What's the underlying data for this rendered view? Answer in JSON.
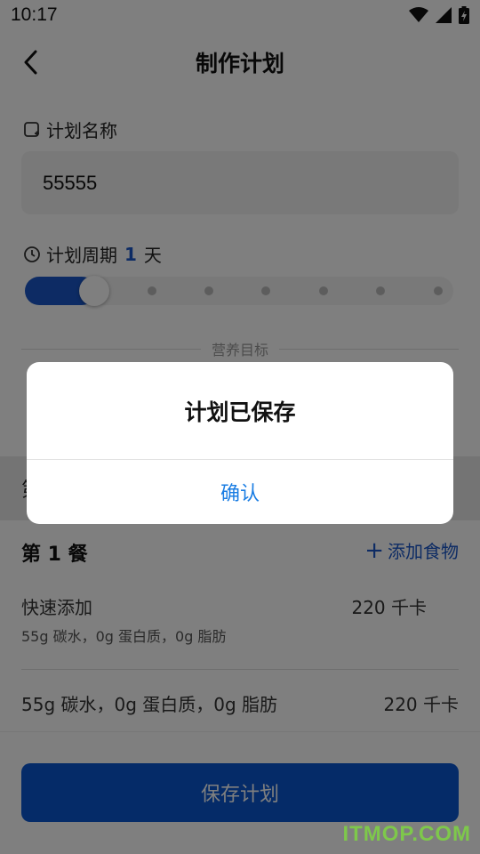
{
  "status_bar": {
    "time": "10:17",
    "icons": [
      "wifi-icon",
      "signal-icon",
      "battery-charging-icon"
    ]
  },
  "header": {
    "title": "制作计划",
    "back_icon": "chevron-left-icon"
  },
  "plan_name": {
    "label": "计划名称",
    "icon": "edit-box-icon",
    "value": "55555"
  },
  "plan_period": {
    "label_prefix": "计划周期",
    "days": "1",
    "label_suffix": "天",
    "icon": "clock-icon",
    "slider_level": 1,
    "slider_steps": 7
  },
  "nutrition_divider": {
    "label": "营养目标"
  },
  "meal_band": {
    "peek_text": "第"
  },
  "meal": {
    "title": "第 1 餐",
    "add_food_label": "添加食物",
    "quick_add": {
      "name": "快速添加",
      "kcal": "220 千卡",
      "macros": "55g 碳水，0g 蛋白质，0g 脂肪"
    },
    "summary": {
      "macros": "55g 碳水，0g 蛋白质，0g 脂肪",
      "kcal": "220 千卡"
    }
  },
  "save_button": {
    "label": "保存计划"
  },
  "dialog": {
    "title": "计划已保存",
    "confirm_label": "确认"
  },
  "watermark": "ITMOP.COM",
  "colors": {
    "accent": "#1a57c9",
    "primary_button": "#0a57d1",
    "dialog_button_text": "#1a7de3",
    "overlay": "rgba(0,0,0,0.5)"
  }
}
